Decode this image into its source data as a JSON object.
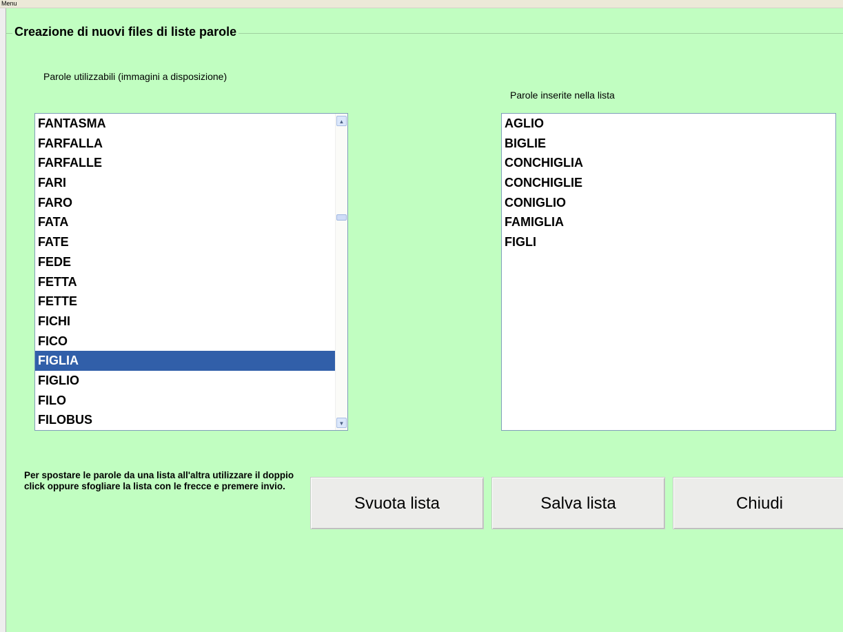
{
  "menu": {
    "label": "Menu"
  },
  "group": {
    "title": "Creazione di nuovi files di liste parole"
  },
  "available": {
    "label": "Parole utilizzabili (immagini a disposizione)",
    "items": [
      "FANTASMA",
      "FARFALLA",
      "FARFALLE",
      "FARI",
      "FARO",
      "FATA",
      "FATE",
      "FEDE",
      "FETTA",
      "FETTE",
      "FICHI",
      "FICO",
      "FIGLIA",
      "FIGLIO",
      "FILO",
      "FILOBUS"
    ],
    "selected_index": 12
  },
  "inserted": {
    "label": "Parole inserite nella lista",
    "items": [
      "AGLIO",
      "BIGLIE",
      "CONCHIGLIA",
      "CONCHIGLIE",
      "CONIGLIO",
      "FAMIGLIA",
      "FIGLI"
    ]
  },
  "instructions": "Per spostare le parole da una lista all'altra utilizzare il doppio click oppure sfogliare la lista con le frecce e premere invio.",
  "buttons": {
    "clear": "Svuota lista",
    "save": "Salva lista",
    "close": "Chiudi"
  },
  "icons": {
    "scroll_up": "chevron-up-icon",
    "scroll_down": "chevron-down-icon"
  },
  "colors": {
    "background": "#c1fec1",
    "selection": "#315fa9"
  }
}
